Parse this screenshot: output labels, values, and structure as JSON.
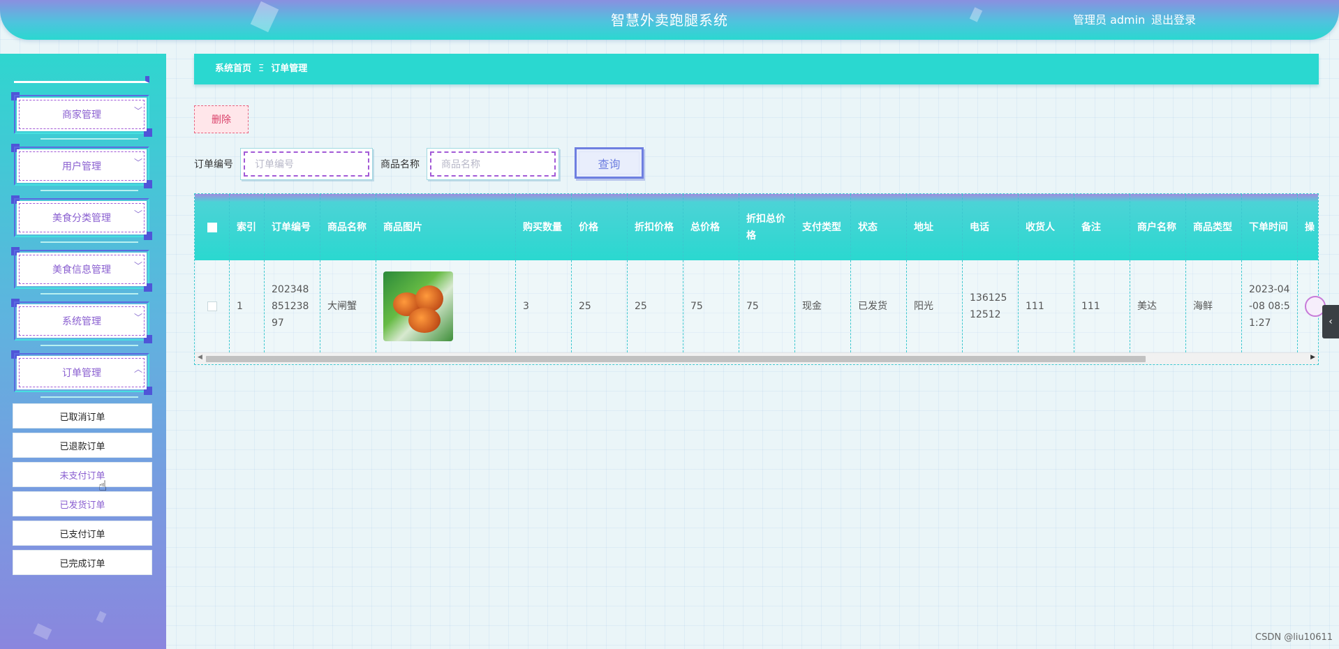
{
  "header": {
    "title": "智慧外卖跑腿系统",
    "user": "管理员 admin",
    "logout": "退出登录"
  },
  "sidebar": {
    "menus": [
      {
        "label": "商家管理",
        "chevron": "﹀"
      },
      {
        "label": "用户管理",
        "chevron": "﹀"
      },
      {
        "label": "美食分类管理",
        "chevron": "﹀"
      },
      {
        "label": "美食信息管理",
        "chevron": "﹀"
      },
      {
        "label": "系统管理",
        "chevron": "﹀"
      },
      {
        "label": "订单管理",
        "chevron": "︿"
      }
    ],
    "submenu": [
      "已取消订单",
      "已退款订单",
      "未支付订单",
      "已发货订单",
      "已支付订单",
      "已完成订单"
    ]
  },
  "breadcrumb": {
    "home": "系统首页",
    "sep": "Ξ",
    "current": "订单管理"
  },
  "toolbar": {
    "delete_label": "删除"
  },
  "search": {
    "order_no_label": "订单编号",
    "order_no_placeholder": "订单编号",
    "product_name_label": "商品名称",
    "product_name_placeholder": "商品名称",
    "query_label": "查询"
  },
  "table": {
    "headers": [
      "索引",
      "订单编号",
      "商品名称",
      "商品图片",
      "购买数量",
      "价格",
      "折扣价格",
      "总价格",
      "折扣总价格",
      "支付类型",
      "状态",
      "地址",
      "电话",
      "收货人",
      "备注",
      "商户名称",
      "商品类型",
      "下单时间",
      "操"
    ],
    "rows": [
      {
        "index": "1",
        "order_no": "20234885123897",
        "product_name": "大闸蟹",
        "quantity": "3",
        "price": "25",
        "discount_price": "25",
        "total": "75",
        "discount_total": "75",
        "pay_type": "现金",
        "status": "已发货",
        "address": "阳光",
        "phone": "13612512512",
        "receiver": "111",
        "remark": "111",
        "merchant": "美达",
        "category": "海鲜",
        "order_time": "2023-04-08 08:51:27"
      }
    ]
  },
  "watermark": "CSDN @liu10611",
  "colors": {
    "accent_cyan": "#2ad8d0",
    "accent_purple": "#8a5fd0",
    "delete_red": "#d9416a"
  }
}
